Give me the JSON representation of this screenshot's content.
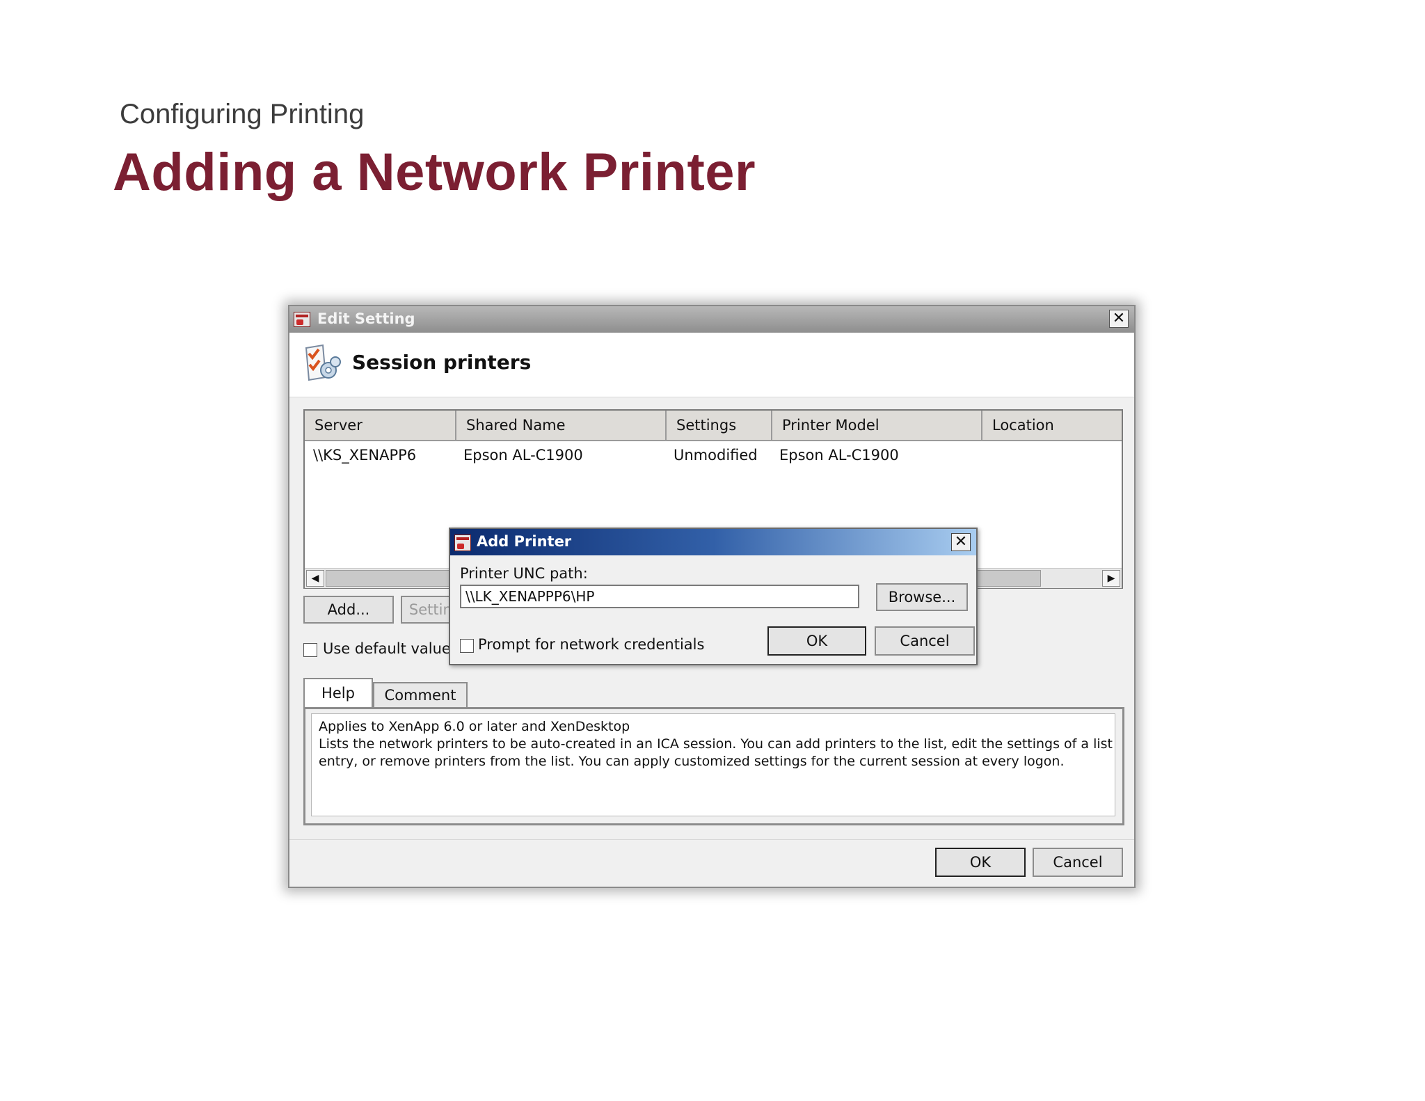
{
  "slide": {
    "section": "Configuring Printing",
    "title": "Adding a Network Printer"
  },
  "window": {
    "title": "Edit Setting",
    "header_title": "Session printers",
    "columns": [
      "Server",
      "Shared Name",
      "Settings",
      "Printer Model",
      "Location"
    ],
    "rows": [
      {
        "server": "\\\\KS_XENAPP6",
        "shared_name": "Epson AL-C1900",
        "settings": "Unmodified",
        "printer_model": "Epson AL-C1900",
        "location": ""
      }
    ],
    "buttons": {
      "add": "Add...",
      "settings": "Settings..."
    },
    "use_default_label": "Use default value",
    "tabs": [
      {
        "label": "Help",
        "active": true
      },
      {
        "label": "Comment",
        "active": false
      }
    ],
    "help_lines": [
      "Applies to XenApp 6.0 or later and XenDesktop",
      "Lists the network printers to be auto-created in an ICA session.  You can add printers to the list, edit the settings of a list",
      "entry, or remove printers from the list. You can apply customized settings for the current session at every logon."
    ],
    "ok_label": "OK",
    "cancel_label": "Cancel"
  },
  "dialog": {
    "title": "Add Printer",
    "unc_label": "Printer UNC path:",
    "unc_value": "\\\\LK_XENAPPP6\\HP",
    "browse_label": "Browse...",
    "prompt_label": "Prompt for network credentials",
    "ok_label": "OK",
    "cancel_label": "Cancel"
  },
  "icons": {
    "title_icon": "printer-settings-icon",
    "header_icon": "policy-settings-icon",
    "close": "close-icon",
    "scroll_left": "arrow-left-icon",
    "scroll_right": "arrow-right-icon"
  },
  "colors": {
    "title_accent": "#7b1f32",
    "dialog_titlebar_start": "#0b2a6e",
    "dialog_titlebar_end": "#a9cdf0"
  }
}
